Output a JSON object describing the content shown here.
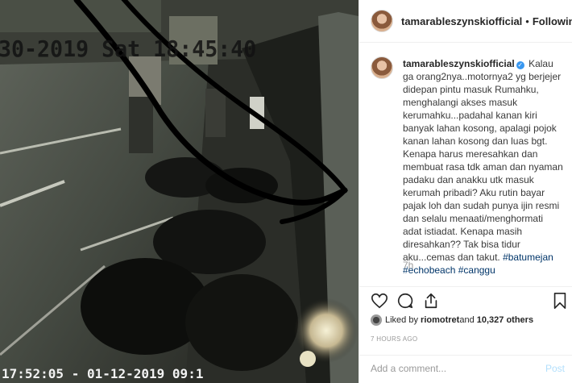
{
  "post": {
    "media": {
      "timestamp_top": "30-2019 Sat 18:45:40",
      "timestamp_bottom": "17:52:05 - 01-12-2019 09:1"
    },
    "header": {
      "username": "tamarableszynskiofficial",
      "separator": "•",
      "follow_status": "Following"
    },
    "caption": {
      "username": "tamarableszynskiofficial",
      "verified_icon": "✓",
      "text": " Kalau ga orang2nya..motornya2 yg berjejer didepan pintu masuk Rumahku, menghalangi akses masuk kerumahku...padahal kanan kiri banyak lahan kosong, apalagi pojok kanan lahan kosong dan luas bgt. Kenapa harus meresahkan dan membuat rasa tdk aman dan nyaman padaku dan anakku utk masuk kerumah pribadi? Aku rutin bayar pajak loh dan sudah punya ijin resmi dan selalu menaati/menghormati adat istiadat. Kenapa masih diresahkan?? Tak bisa tidur aku...cemas dan takut. ",
      "tags": [
        "#batumejan",
        "#echobeach",
        "#canggu"
      ],
      "age": "7h"
    },
    "actions": {
      "icons": [
        "heart-icon",
        "comment-icon",
        "share-icon",
        "bookmark-icon"
      ]
    },
    "likes": {
      "prefix": "Liked by ",
      "user": "riomotret",
      "middle": " and ",
      "count": "10,327 others"
    },
    "time_ago": "7 HOURS AGO",
    "comment": {
      "placeholder": "Add a comment...",
      "post_label": "Post"
    },
    "colors": {
      "link": "#003569",
      "verified": "#3897f0",
      "post_disabled": "#b2dffc",
      "muted": "#999999"
    }
  }
}
